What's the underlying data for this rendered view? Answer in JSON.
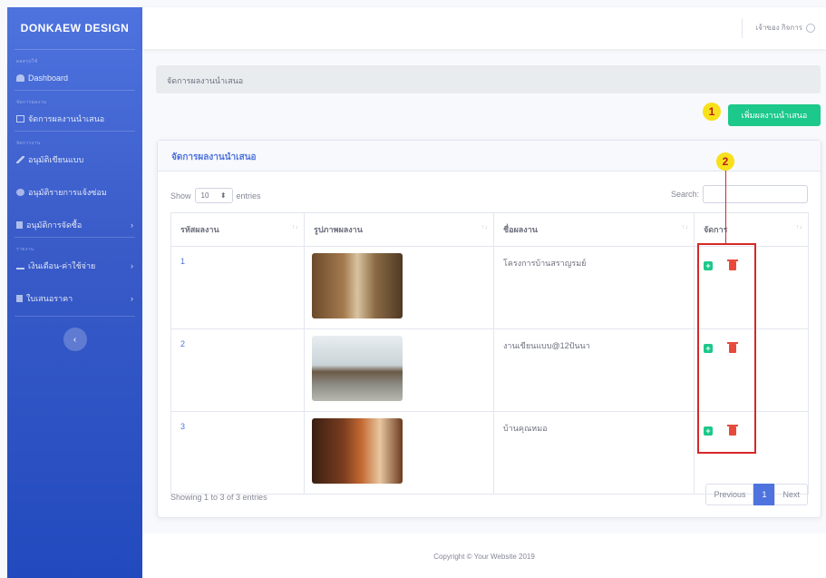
{
  "sidebar": {
    "brand": "DONKAEW DESIGN",
    "headings": [
      "ผลสรุปใช้",
      "จัดการผลงาน",
      "จัดการงาน",
      "รายงาน"
    ],
    "items": [
      {
        "label": "Dashboard",
        "icon": "dashboard-icon"
      },
      {
        "label": "จัดการผลงานนำเสนอ",
        "icon": "table-icon"
      },
      {
        "label": "อนุมัติเขียนแบบ",
        "icon": "pen-icon"
      },
      {
        "label": "อนุมัติรายการแจ้งซ่อม",
        "icon": "chat-icon"
      },
      {
        "label": "อนุมัติการจัดซื้อ",
        "icon": "file-icon"
      },
      {
        "label": "เงินเดือน-ค่าใช้จ่าย",
        "icon": "money-icon"
      },
      {
        "label": "ใบเสนอราคา",
        "icon": "file-icon"
      }
    ],
    "toggle": "‹",
    "chevron": "›"
  },
  "topbar": {
    "user_name": "เจ้าของ กิจการ"
  },
  "breadcrumb": "จัดการผลงานนำเสนอ",
  "add_button": "เพิ่มผลงานนำเสนอ",
  "markers": [
    "1",
    "2"
  ],
  "card": {
    "title": "จัดการผลงานนำเสนอ",
    "show_label": "Show",
    "entries_value": "10",
    "entries_label": "entries",
    "search_label": "Search:",
    "columns": [
      "รหัสผลงาน",
      "รูปภาพผลงาน",
      "ชื่อผลงาน",
      "จัดการ"
    ],
    "sort_glyph": "↑↓",
    "rows": [
      {
        "code": "1",
        "name": "โครงการบ้านสราญรมย์"
      },
      {
        "code": "2",
        "name": "งานเขียนแบบ@12ปันนา"
      },
      {
        "code": "3",
        "name": "บ้านคุณหมอ"
      }
    ],
    "info": "Showing 1 to 3 of 3 entries",
    "pager": {
      "previous": "Previous",
      "current": "1",
      "next": "Next"
    }
  },
  "footer": "Copyright © Your Website 2019",
  "colors": {
    "primary": "#4e73df",
    "success": "#1cc88a",
    "danger": "#e74a3b",
    "annotation": "#d62828"
  }
}
